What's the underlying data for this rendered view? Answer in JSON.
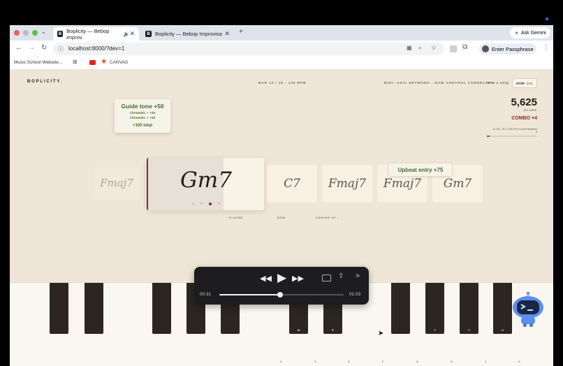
{
  "browser": {
    "tabs": [
      {
        "favicon": "B",
        "title": "Boplicity — Bebop improv",
        "active": true
      },
      {
        "favicon": "B",
        "title": "Boplicity — Bebop Improvisa",
        "active": false
      }
    ],
    "new_tab": "+",
    "ask_gemini": "Ask Gemini",
    "url": "localhost:8000/?dev=1",
    "passphrase": "Enter Passphrase",
    "bookmarks": [
      {
        "label": "Music School Website..."
      },
      {
        "label": "CANVAS"
      }
    ]
  },
  "app": {
    "logo": "BOPLICITY.",
    "bar_status": "BAR 13 / 16 · 130 BPM",
    "midi_status": "MIDI: AKAI NETWORK - DAW CONTROL CONNECTED",
    "extra_status": "D▾+C ▸ 1m/g",
    "stop_label": "STOP",
    "stop_key": "ESC"
  },
  "score": {
    "value": "5,625",
    "label": "SCORE",
    "combo": "COMBO ×4",
    "note": "to 10k · 30 / 1,100 XP to Level Headliner",
    "progress_value": "8",
    "progress": 0.05
  },
  "guide_popup": {
    "title": "Guide tone +50",
    "lines": [
      "Chromatic ✓ +25",
      "Chromatic ✓ +25"
    ],
    "total": "+100 total"
  },
  "upbeat_popup": "Upbeat entry +75",
  "chords": {
    "played": "Fmaj7",
    "now": "Gm7",
    "upcoming": [
      "C7",
      "Fmaj7",
      "Fmaj7",
      "Gm7"
    ]
  },
  "beat_dots": 4,
  "beat_active": 3,
  "timeline_labels": {
    "played": "‹ PLAYED",
    "now": "NOW",
    "coming": "COMING UP ›"
  },
  "media": {
    "current": "00:31",
    "total": "01:03",
    "progress": 0.49
  },
  "keyboard": {
    "black_labels": [
      "",
      "",
      "",
      "",
      "",
      "W",
      "E",
      "",
      "T",
      "Y",
      "U"
    ],
    "white_labels": [
      "A",
      "S",
      "D",
      "F",
      "G",
      "H",
      "J",
      "K"
    ]
  },
  "colors": {
    "accent": "#8a2a2a",
    "guide_green": "#3f6b2f",
    "page_bg": "#efe6d7"
  }
}
